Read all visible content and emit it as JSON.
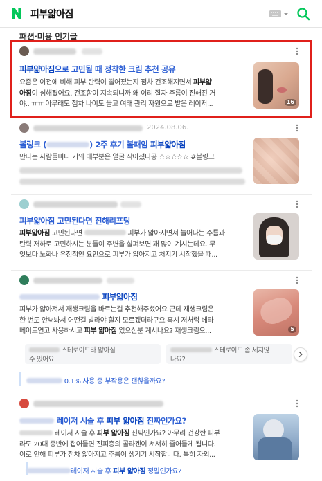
{
  "header": {
    "query": "피부얇아짐"
  },
  "section": {
    "title": "패션·미용 인기글"
  },
  "posts": [
    {
      "date": "",
      "title_hl": "피부얇아짐",
      "title_rest": "으로 고민될 때 정착한 크림 추천 공유",
      "body_line1": "요즘은 이전에 비해 피부 탄력이 떨어졌는지 점차 건조해지면서 ",
      "body_hl1": "피부얇",
      "body_hl2": "아짐",
      "body_line2": "이 심해졌어요. 건조함이 지속되니까 왜 이리 잘자 주름이 진해진 거",
      "body_line3": "야.. ㅠㅠ 아무래도 점차 나이도 들고 여태 관리 자원으로 받은 레이저...",
      "image_count": "16"
    },
    {
      "date": "2024.08.06.",
      "title_a": "볼링크 (",
      "title_b": ") 2주 후기 볼패임 ",
      "title_hl": "피부얇아짐",
      "body_line1": "만나는 사람들마다 거의 대부분은 얼굴 작아졌다공 ☆☆☆☆☆ #볼링크"
    },
    {
      "title": "피부얇아짐 고민된다면 진해리프팅",
      "body_hl": "피부얇아짐",
      "body_line1": " 고민된다면 ",
      "body_line1b": " 피부가 얇아지면서 늘어나는 주름과",
      "body_line2": "탄력 저하로 고민하시는 분들이 주변을 살펴보면 꽤 많이 계시는데요. 무",
      "body_line3": "엇보다 노화나 유전적인 요인으로 피부가 얇아지고 처지기 시작했을 때..."
    },
    {
      "title_hl": "피부얇아짐",
      "body_line1": "피부가 얇아져서 재생크림을 바르는걸 추천해주셨어요 근데 재생크림은",
      "body_line2": "한 번도 안써봐서 어떤걸 발라야 할지 모르겠더라구요 혹시 저처럼 베타",
      "body_line3a": "베이트연고 사용하시고 ",
      "body_line3hl": "피부 얇아짐",
      "body_line3b": " 있으신분 계시나요? 재생크림으...",
      "image_count": "5",
      "chips": [
        {
          "text_a": " 스테로이드라 얇아질",
          "text_b": "수 있어요"
        },
        {
          "text_a": " 스테로이드 좀 세지않",
          "text_b": "나요?"
        }
      ],
      "related": "0.1% 사용 중 부작용은 괜찮을까요?"
    },
    {
      "title_a": " 레이저 시술 후 ",
      "title_hl": "피부 얇아짐",
      "title_b": " 진짜인가요?",
      "body_line1": " 레이저 시술 후 ",
      "body_hl": "피부 얇아짐",
      "body_line1b": " 진짜인가요? 아무리 건강한 피부",
      "body_line2": "라도 20대 중반에 접어들면 진피층의 콜라겐이 서서히 줄어들게 됩니다.",
      "body_line3": "이로 인해 피부가 점차 얇아지고 주름이 생기기 시작합니다. 특히 자외...",
      "related_a": "레이저 시술 후 ",
      "related_hl": "피부 얇아짐",
      "related_b": " 정말인가요?"
    }
  ],
  "colors": {
    "link": "#2d5fd4",
    "highlight_box": "#e0201b",
    "naver_green": "#03c75a"
  }
}
